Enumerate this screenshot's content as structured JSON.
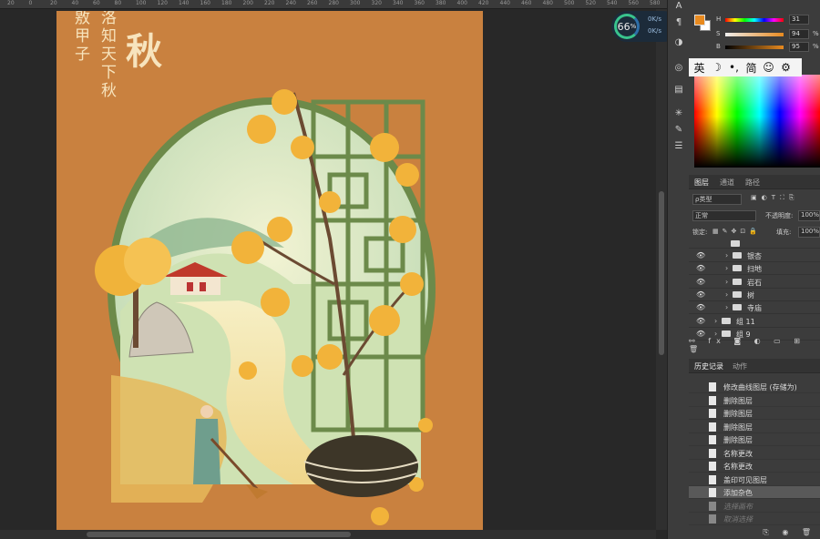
{
  "ruler": {
    "ticks": [
      "20",
      "0",
      "20",
      "40",
      "60",
      "80",
      "100",
      "120",
      "140",
      "160",
      "180",
      "200",
      "220",
      "240",
      "260",
      "280",
      "300",
      "320",
      "340",
      "360",
      "380",
      "400",
      "420",
      "440",
      "460",
      "480",
      "500",
      "520",
      "540",
      "560",
      "580"
    ]
  },
  "artwork": {
    "line1": "敫甲子",
    "line2": "洛知天下秋",
    "title": "秋"
  },
  "zoom": {
    "percent": "66",
    "suffix": "%",
    "up": "0K/s",
    "down": "0K/s"
  },
  "color": {
    "foreground": "#e88a1f",
    "rows": [
      {
        "label": "H",
        "value": "31",
        "unit": ""
      },
      {
        "label": "S",
        "value": "94",
        "unit": "%"
      },
      {
        "label": "B",
        "value": "95",
        "unit": "%"
      }
    ]
  },
  "ime": {
    "items": [
      "英",
      "☽",
      "•,",
      "简",
      "☺",
      "⚙"
    ]
  },
  "layers_tabs": [
    "图层",
    "通道",
    "路径"
  ],
  "layers_controls": {
    "filter": "ρ类型",
    "blend": "正常",
    "opacity_label": "不透明度:",
    "opacity": "100%",
    "lock_label": "锁定:",
    "fill_label": "填充:",
    "fill": "100%"
  },
  "layers": [
    {
      "name": "银杏",
      "indent": 1
    },
    {
      "name": "扫地",
      "indent": 1
    },
    {
      "name": "岩石",
      "indent": 1
    },
    {
      "name": "树",
      "indent": 1
    },
    {
      "name": "寺庙",
      "indent": 1
    },
    {
      "name": "组 11",
      "indent": 0
    },
    {
      "name": "组 9",
      "indent": 0
    }
  ],
  "history_tabs": [
    "历史记录",
    "动作"
  ],
  "history": [
    {
      "text": "修改曲线图层 (存储为)",
      "state": "normal"
    },
    {
      "text": "删除图层",
      "state": "normal"
    },
    {
      "text": "删除图层",
      "state": "normal"
    },
    {
      "text": "删除图层",
      "state": "normal"
    },
    {
      "text": "删除图层",
      "state": "normal"
    },
    {
      "text": "名称更改",
      "state": "normal"
    },
    {
      "text": "名称更改",
      "state": "normal"
    },
    {
      "text": "盖印可见图层",
      "state": "normal"
    },
    {
      "text": "添加杂色",
      "state": "selected"
    },
    {
      "text": "选择画布",
      "state": "dim"
    },
    {
      "text": "取消选择",
      "state": "dim"
    }
  ]
}
